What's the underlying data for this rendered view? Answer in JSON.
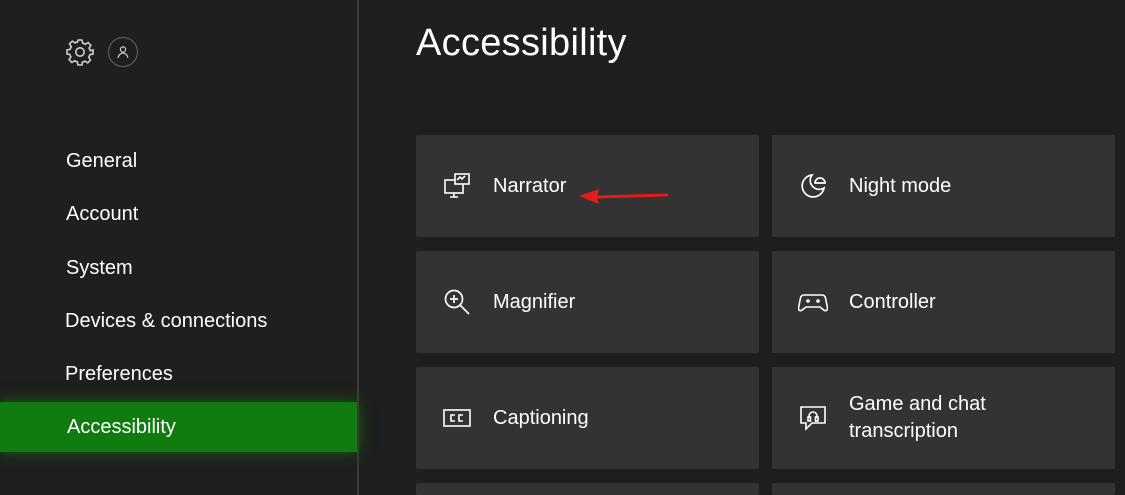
{
  "sidebar": {
    "settings_icon": "gear-icon",
    "profile_icon": "person-icon",
    "items": [
      {
        "label": "General"
      },
      {
        "label": "Account"
      },
      {
        "label": "System"
      },
      {
        "label": "Devices & connections"
      },
      {
        "label": "Preferences"
      },
      {
        "label": "Accessibility",
        "active": true
      }
    ],
    "active_color": "#107c10"
  },
  "main": {
    "title": "Accessibility",
    "tiles": [
      {
        "label": "Narrator",
        "icon": "narrator-icon"
      },
      {
        "label": "Night mode",
        "icon": "night-mode-icon"
      },
      {
        "label": "Magnifier",
        "icon": "magnifier-icon"
      },
      {
        "label": "Controller",
        "icon": "controller-icon"
      },
      {
        "label": "Captioning",
        "icon": "captioning-icon"
      },
      {
        "label": "Game and chat transcription",
        "icon": "chat-transcription-icon"
      }
    ]
  },
  "annotation": {
    "arrow_color": "#e41b17"
  }
}
